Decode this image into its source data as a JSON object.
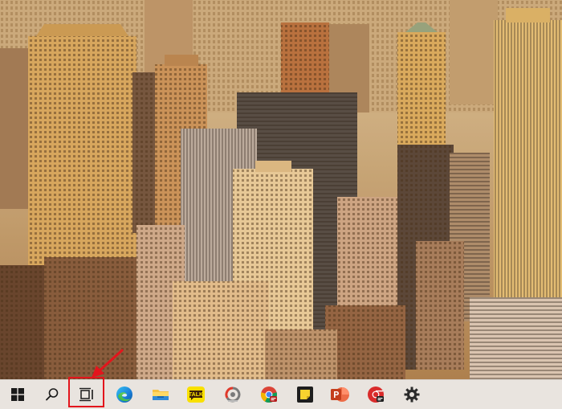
{
  "desktop": {
    "wallpaper_icon": "city-skyline-wallpaper"
  },
  "taskbar": {
    "items": [
      {
        "id": "start",
        "icon": "windows-logo-icon"
      },
      {
        "id": "search",
        "icon": "search-icon"
      },
      {
        "id": "task-view",
        "icon": "task-view-icon",
        "highlighted": true
      },
      {
        "id": "edge",
        "icon": "edge-browser-icon"
      },
      {
        "id": "file-explorer",
        "icon": "folder-icon"
      },
      {
        "id": "kakaotalk",
        "icon": "kakaotalk-icon",
        "label": "TALK"
      },
      {
        "id": "photo-app",
        "icon": "photo-scape-icon"
      },
      {
        "id": "chrome",
        "icon": "chrome-icon"
      },
      {
        "id": "sticky-notes",
        "icon": "sticky-notes-icon"
      },
      {
        "id": "powerpoint",
        "icon": "powerpoint-icon"
      },
      {
        "id": "chrome-profile",
        "icon": "chrome-profile-icon"
      },
      {
        "id": "settings",
        "icon": "gear-icon"
      }
    ]
  },
  "annotation": {
    "color": "#e3151c",
    "target": "task-view"
  },
  "colors": {
    "taskbar_bg": "#e9e4df",
    "highlight": "#e3151c"
  }
}
